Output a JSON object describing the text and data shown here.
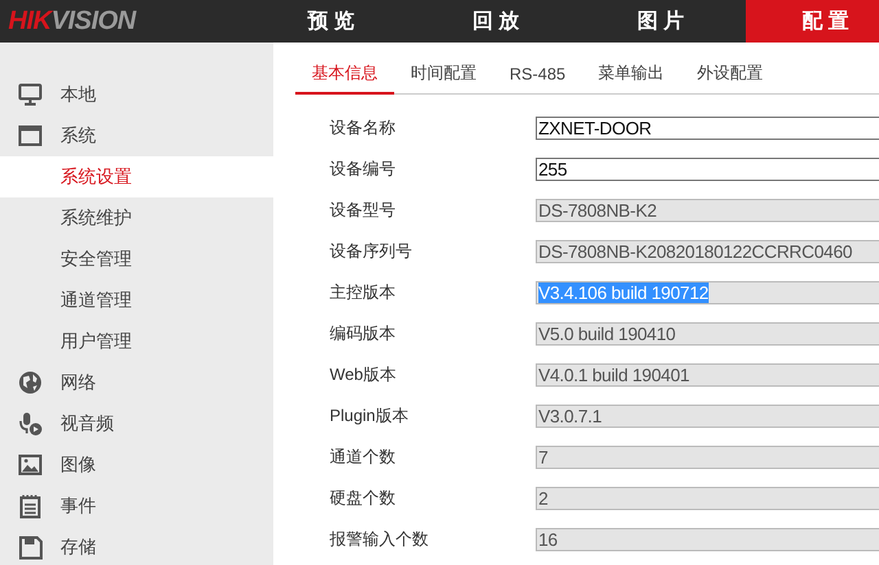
{
  "logo": {
    "part_1": "HIK",
    "part_2": "VISION"
  },
  "nav": [
    {
      "label": "预览",
      "selected": false
    },
    {
      "label": "回放",
      "selected": false
    },
    {
      "label": "图片",
      "selected": false
    },
    {
      "label": "配置",
      "selected": true
    }
  ],
  "sidebar": {
    "items": [
      {
        "label": "本地",
        "selected": false
      },
      {
        "label": "系统",
        "selected": false,
        "children": [
          {
            "label": "系统设置",
            "selected": true
          },
          {
            "label": "系统维护",
            "selected": false
          },
          {
            "label": "安全管理",
            "selected": false
          },
          {
            "label": "通道管理",
            "selected": false
          },
          {
            "label": "用户管理",
            "selected": false
          }
        ]
      },
      {
        "label": "网络",
        "selected": false
      },
      {
        "label": "视音频",
        "selected": false
      },
      {
        "label": "图像",
        "selected": false
      },
      {
        "label": "事件",
        "selected": false
      },
      {
        "label": "存储",
        "selected": false
      }
    ]
  },
  "tabs": [
    {
      "label": "基本信息",
      "selected": true
    },
    {
      "label": "时间配置",
      "selected": false
    },
    {
      "label": "RS-485",
      "selected": false
    },
    {
      "label": "菜单输出",
      "selected": false
    },
    {
      "label": "外设配置",
      "selected": false
    }
  ],
  "fields": [
    {
      "label": "设备名称",
      "value": "ZXNET-DOOR",
      "disabled": false,
      "text_selected": false
    },
    {
      "label": "设备编号",
      "value": "255",
      "disabled": false,
      "text_selected": false
    },
    {
      "label": "设备型号",
      "value": "DS-7808NB-K2",
      "disabled": true,
      "text_selected": false
    },
    {
      "label": "设备序列号",
      "value": "DS-7808NB-K20820180122CCRRC0460",
      "disabled": true,
      "text_selected": false
    },
    {
      "label": "主控版本",
      "value": "V3.4.106 build 190712",
      "disabled": true,
      "text_selected": true
    },
    {
      "label": "编码版本",
      "value": "V5.0 build 190410",
      "disabled": true,
      "text_selected": false
    },
    {
      "label": "Web版本",
      "value": "V4.0.1 build 190401",
      "disabled": true,
      "text_selected": false
    },
    {
      "label": "Plugin版本",
      "value": "V3.0.7.1",
      "disabled": true,
      "text_selected": false
    },
    {
      "label": "通道个数",
      "value": "7",
      "disabled": true,
      "text_selected": false
    },
    {
      "label": "硬盘个数",
      "value": "2",
      "disabled": true,
      "text_selected": false
    },
    {
      "label": "报警输入个数",
      "value": "16",
      "disabled": true,
      "text_selected": false
    }
  ]
}
